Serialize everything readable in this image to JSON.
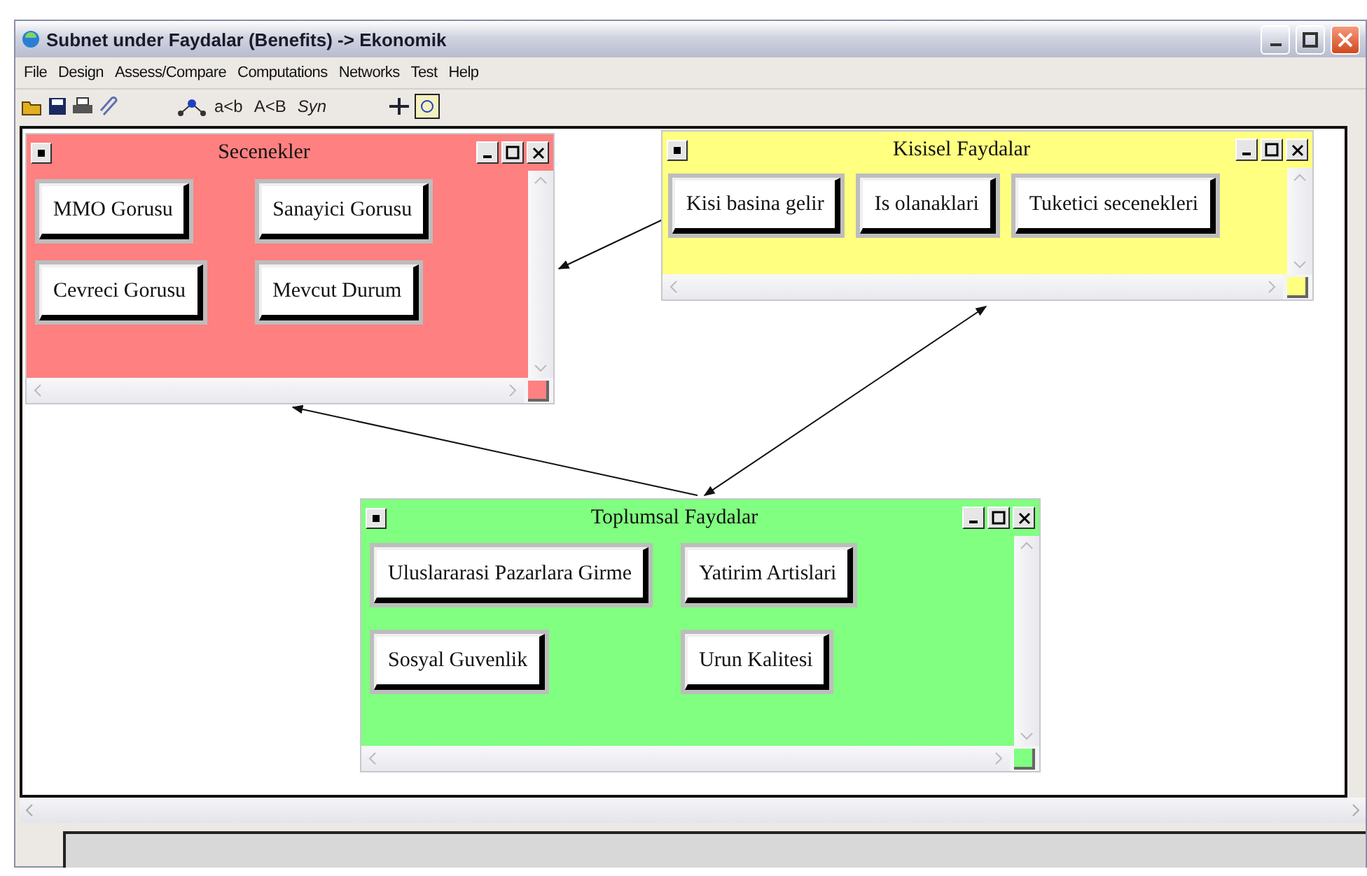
{
  "window": {
    "title": "Subnet under Faydalar (Benefits) -> Ekonomik"
  },
  "menu": [
    "File",
    "Design",
    "Assess/Compare",
    "Computations",
    "Networks",
    "Test",
    "Help"
  ],
  "toolbar": {
    "text_buttons": [
      "a<b",
      "A<B",
      "Syn"
    ]
  },
  "subwindows": [
    {
      "title": "Secenekler",
      "color": "#ff8080",
      "nodes": [
        "MMO Gorusu",
        "Sanayici Gorusu",
        "Cevreci Gorusu",
        "Mevcut Durum"
      ]
    },
    {
      "title": "Kisisel Faydalar",
      "color": "#ffff80",
      "nodes": [
        "Kisi basina gelir",
        "Is olanaklari",
        "Tuketici secenekleri"
      ]
    },
    {
      "title": "Toplumsal Faydalar",
      "color": "#80ff80",
      "nodes": [
        "Uluslararasi Pazarlara Girme",
        "Yatirim Artislari",
        "Sosyal Guvenlik",
        "Urun Kalitesi"
      ]
    }
  ]
}
